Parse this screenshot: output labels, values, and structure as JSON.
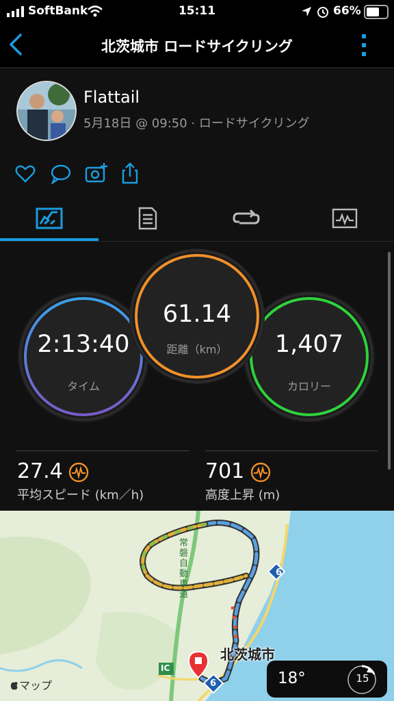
{
  "status_bar": {
    "carrier": "SoftBank",
    "time": "15:11",
    "battery": "66%"
  },
  "nav": {
    "title": "北茨城市 ロードサイクリング",
    "back_icon": "chevron-left-icon",
    "more_icon": "more-vertical-icon"
  },
  "header": {
    "user_name": "Flattail",
    "meta": "5月18日 @ 09:50 · ロードサイクリング"
  },
  "actions": [
    "heart-icon",
    "comment-icon",
    "add-photo-icon",
    "share-icon"
  ],
  "tabs": [
    "summary-chart-icon",
    "details-document-icon",
    "laps-loop-icon",
    "graph-icon"
  ],
  "stats": {
    "time": {
      "value": "2:13:40",
      "label": "タイム"
    },
    "distance": {
      "value": "61.14",
      "label": "距離（km）"
    },
    "calories": {
      "value": "1,407",
      "label": "カロリー"
    },
    "avg_speed": {
      "value": "27.4",
      "label": "平均スピード (km／h)"
    },
    "elevation_gain": {
      "value": "701",
      "label": "高度上昇 (m)"
    }
  },
  "map": {
    "city_label": "北茨城市",
    "credit": "マップ",
    "route_badge": "6",
    "road_label": "常磐自動車道",
    "ic_label": "IC",
    "temperature": "18°",
    "wind_value": "15"
  },
  "colors": {
    "accent": "#1a9de0",
    "time_ring_top": "#3aa0e8",
    "time_ring_bottom": "#7a5ac8",
    "distance_ring": "#f0902a",
    "calories_ring": "#2ed23c",
    "metric_icon": "#f0902a"
  }
}
